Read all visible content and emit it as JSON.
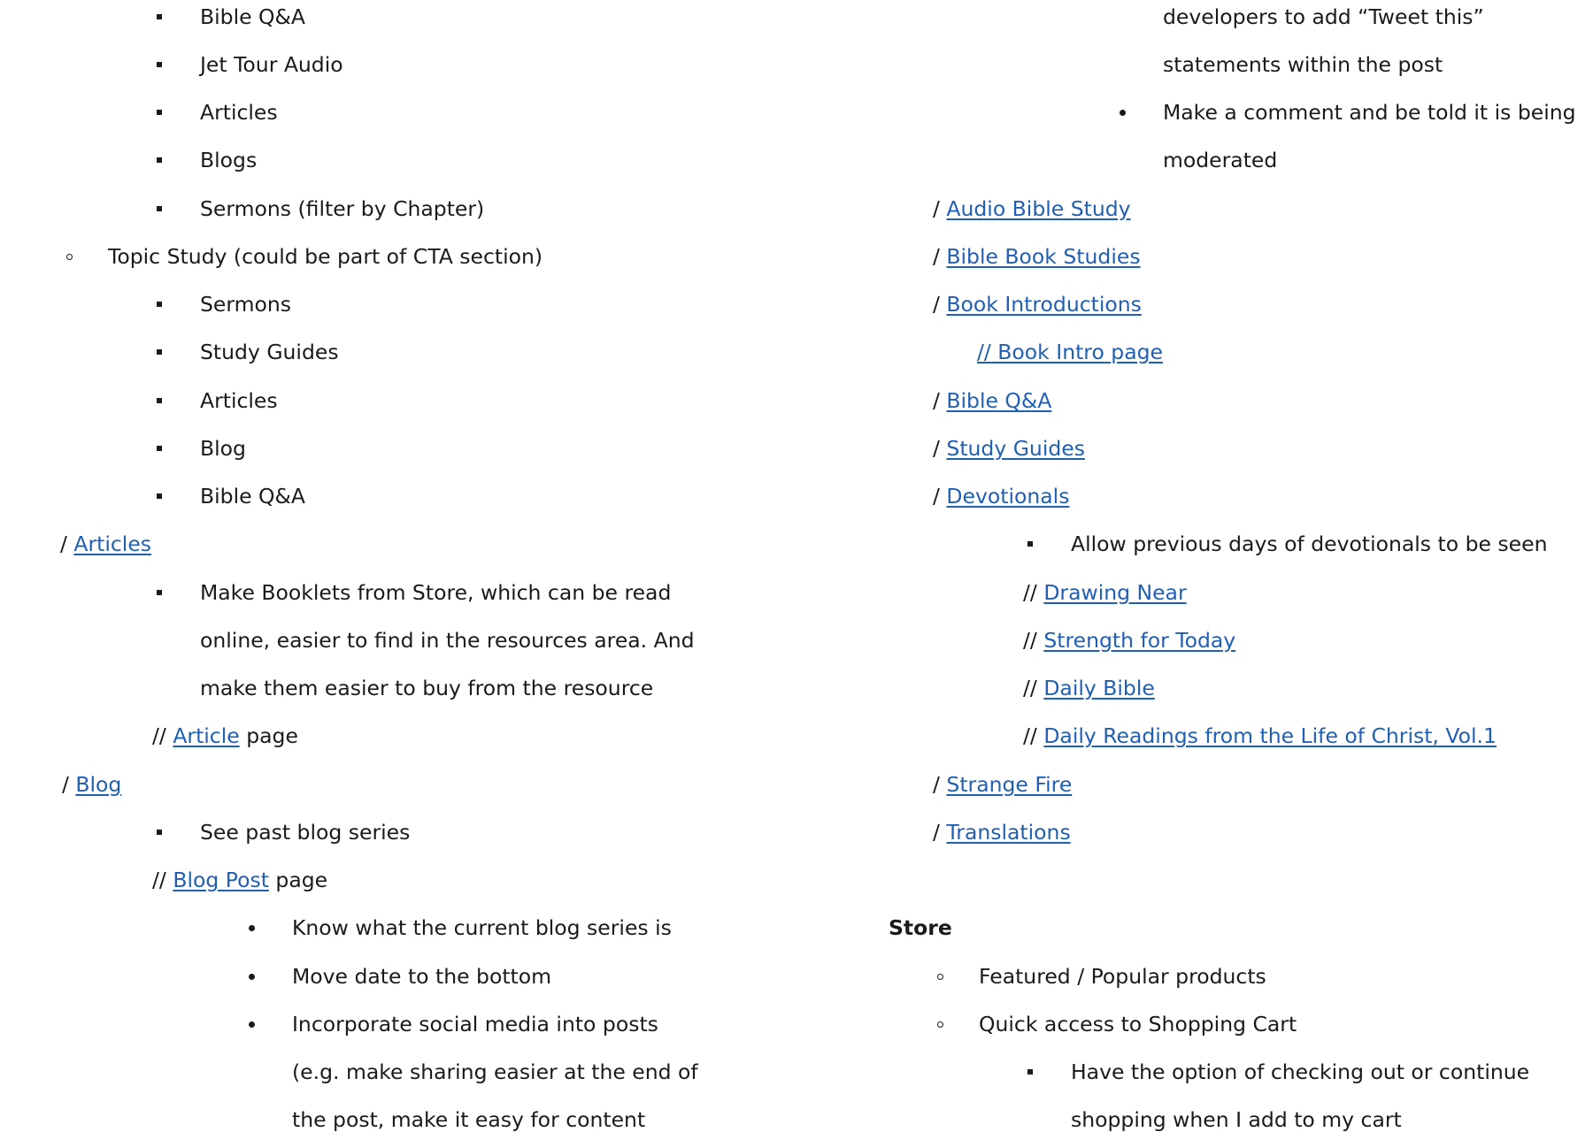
{
  "left_column": {
    "top_sub_items": [
      "Bible Q&A",
      "Jet Tour Audio",
      "Articles",
      "Blogs",
      "Sermons (filter by Chapter)"
    ],
    "topic_study": {
      "label": "Topic Study (could be part of CTA section)",
      "items": [
        "Sermons",
        "Study Guides",
        "Articles",
        "Blog",
        "Bible Q&A"
      ]
    },
    "articles": {
      "prefix": "/",
      "link": "Articles",
      "note_lines": [
        "Make Booklets from Store, which can be read",
        "online, easier to find in the resources area. And",
        "make them easier to buy from the resource"
      ],
      "subpage": {
        "prefix": "//",
        "link": "Article",
        "suffix": "page"
      }
    },
    "blog": {
      "prefix": "/",
      "link": "Blog",
      "note": "See past blog series",
      "subpage": {
        "prefix": "//",
        "link": "Blog Post",
        "suffix": "page"
      },
      "post_items": [
        "Know what the current blog series is",
        "Move date to the bottom",
        "Incorporate social media into posts"
      ],
      "post_continuation": [
        "(e.g. make sharing easier at the end of",
        "the post, make it easy for content"
      ]
    }
  },
  "right_column": {
    "continuation": [
      "developers to add “Tweet this”",
      "statements within the post"
    ],
    "comment_item_lines": [
      "Make a comment and be told it is being",
      "moderated"
    ],
    "resources": [
      {
        "prefix": "/",
        "link": "Audio Bible Study"
      },
      {
        "prefix": "/",
        "link": "Bible Book Studies"
      },
      {
        "prefix": "/",
        "link": "Book Introductions"
      },
      {
        "prefix": "",
        "link": "// Book Intro page"
      },
      {
        "prefix": "/",
        "link": "Bible Q&A"
      },
      {
        "prefix": "/",
        "link": "Study Guides"
      },
      {
        "prefix": "/",
        "link": "Devotionals"
      }
    ],
    "devotionals_note": "Allow previous days of devotionals to be seen",
    "devotionals": [
      {
        "prefix": "//",
        "link": "Drawing Near"
      },
      {
        "prefix": "//",
        "link": "Strength for Today"
      },
      {
        "prefix": "//",
        "link": "Daily Bible"
      },
      {
        "prefix": "//",
        "link": "Daily Readings from the Life of Christ, Vol.1"
      }
    ],
    "more_resources": [
      {
        "prefix": "/",
        "link": "Strange Fire"
      },
      {
        "prefix": "/",
        "link": "Translations"
      }
    ],
    "store": {
      "heading": "Store",
      "items": [
        "Featured / Popular products",
        "Quick access to Shopping Cart"
      ],
      "cart_note_lines": [
        "Have the option of checking out or continue",
        "shopping when I add to my cart"
      ]
    }
  },
  "colors": {
    "link": "#1f5fb5",
    "text": "#1a1a1a"
  }
}
